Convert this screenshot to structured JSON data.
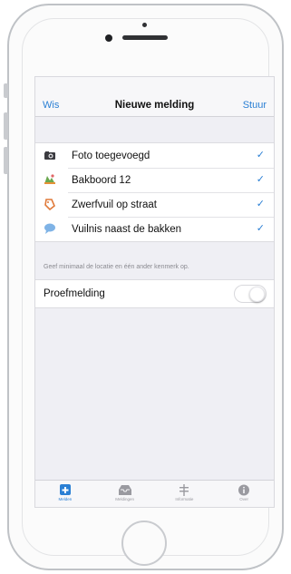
{
  "navbar": {
    "left_label": "Wis",
    "title": "Nieuwe melding",
    "right_label": "Stuur"
  },
  "items": [
    {
      "icon": "camera-icon",
      "label": "Foto toegevoegd",
      "checked": true
    },
    {
      "icon": "map-icon",
      "label": "Bakboord 12",
      "checked": true
    },
    {
      "icon": "tag-icon",
      "label": "Zwerfvuil op straat",
      "checked": true
    },
    {
      "icon": "speech-bubble-icon",
      "label": "Vuilnis naast de bakken",
      "checked": true
    }
  ],
  "footnote": "Geef minimaal de locatie en één ander kenmerk op.",
  "proefmelding": {
    "label": "Proefmelding",
    "enabled": false
  },
  "tabs": [
    {
      "icon": "plus-square-icon",
      "label": "Melden",
      "active": true
    },
    {
      "icon": "inbox-icon",
      "label": "Meldingen",
      "active": false
    },
    {
      "icon": "signpost-icon",
      "label": "Informatie",
      "active": false
    },
    {
      "icon": "info-icon",
      "label": "Over",
      "active": false
    }
  ],
  "check_glyph": "✓",
  "colors": {
    "accent": "#2a7fd4",
    "background": "#efeff4"
  }
}
